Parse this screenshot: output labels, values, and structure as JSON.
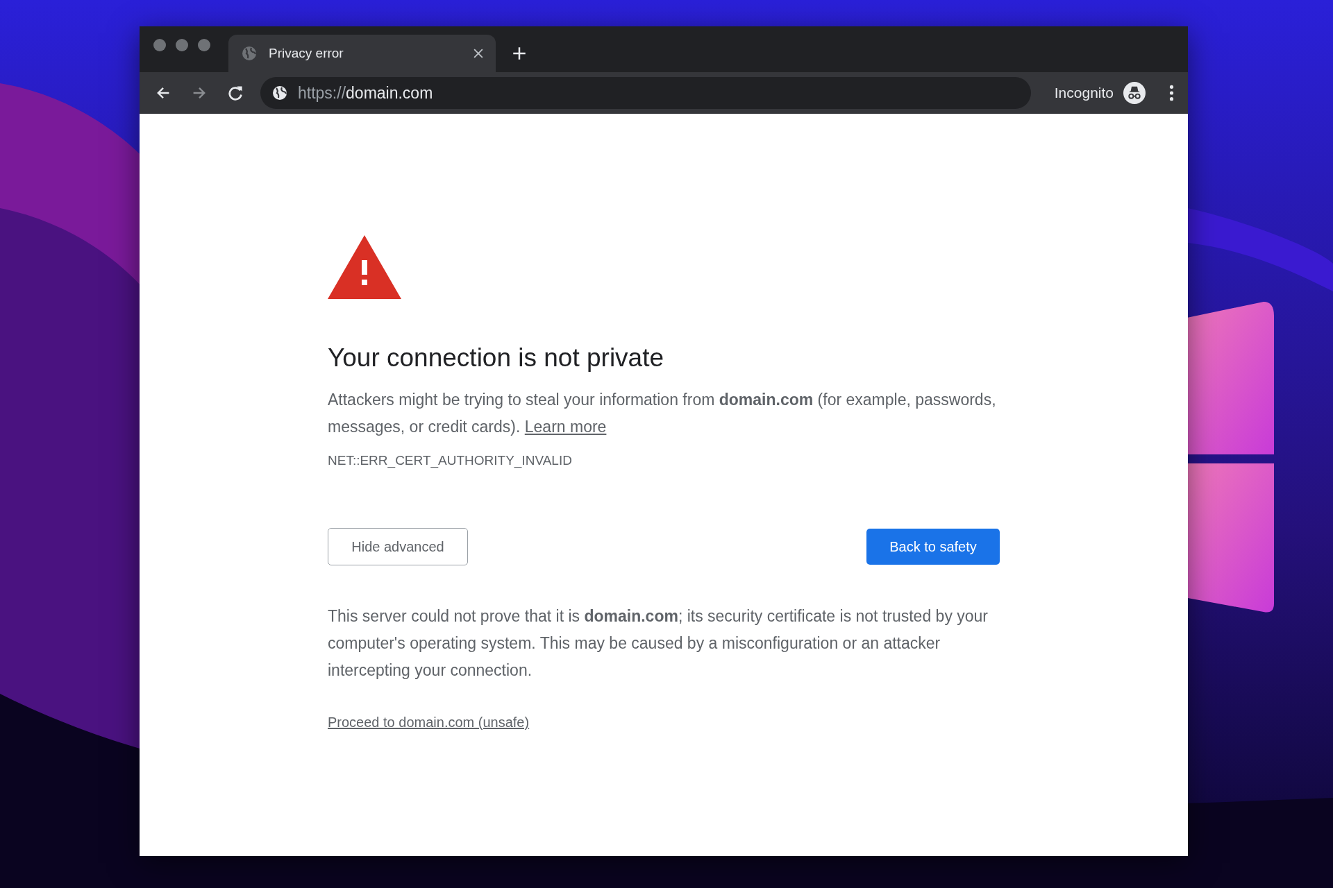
{
  "browser": {
    "tab": {
      "title": "Privacy error",
      "selected": true
    },
    "address": {
      "scheme": "https://",
      "host": "domain.com"
    },
    "profile": {
      "label": "Incognito"
    }
  },
  "page": {
    "heading": "Your connection is not private",
    "intro": {
      "text": "Attackers might be trying to steal your information from **domain.com** (for example, passwords, messages, or credit cards).",
      "link": "Learn more"
    },
    "error_code": "NET::ERR_CERT_AUTHORITY_INVALID",
    "buttons": [
      {
        "label": "Hide advanced",
        "kind": "secondary"
      },
      {
        "label": "Back to safety",
        "kind": "primary"
      }
    ],
    "details": "This server could not prove that it is **domain.com**; its security certificate is not trusted by your computer's operating system. This may be caused by a misconfiguration or an attacker intercepting your connection.",
    "proceed_link": "Proceed to domain.com (unsafe)"
  }
}
